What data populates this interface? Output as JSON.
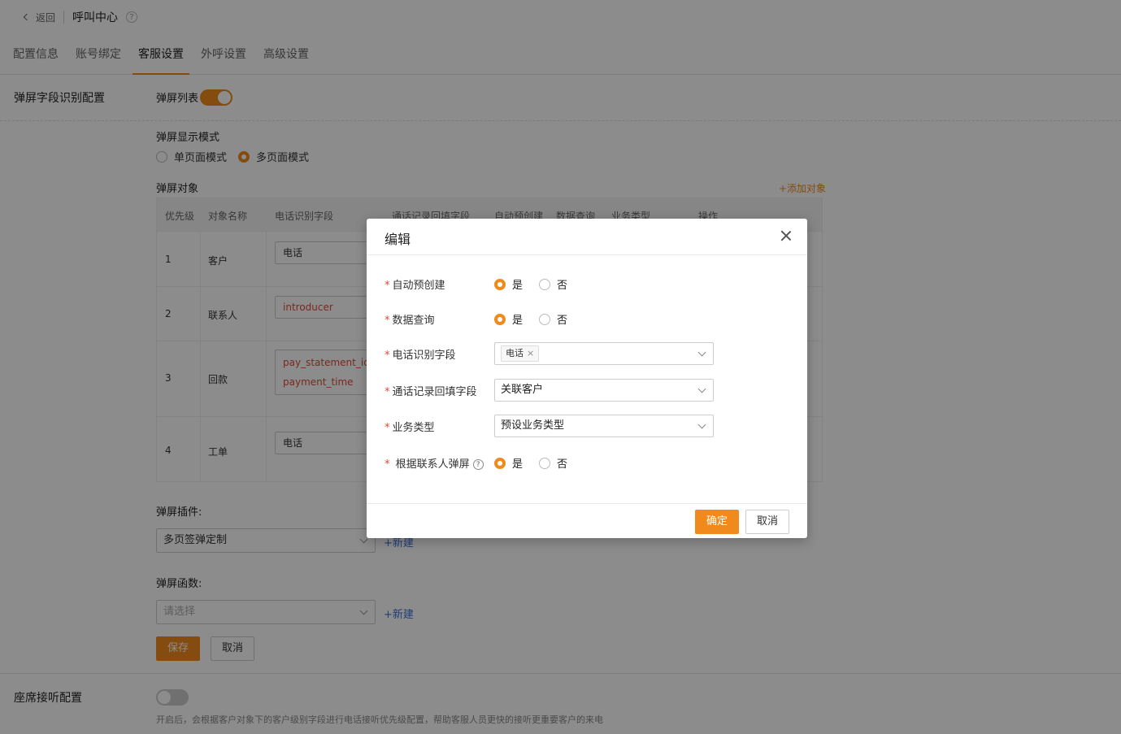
{
  "topbar": {
    "back": "返回",
    "title": "呼叫中心",
    "help": "?"
  },
  "tabs": [
    "配置信息",
    "账号绑定",
    "客服设置",
    "外呼设置",
    "高级设置"
  ],
  "popup_section": {
    "label": "弹屏字段识别配置",
    "list_label": "弹屏列表",
    "list_enabled": true,
    "display_mode_label": "弹屏显示模式",
    "display_modes": [
      "单页面模式",
      "多页面模式"
    ],
    "display_mode_selected": "多页面模式",
    "objects_label": "弹屏对象",
    "add_object": "+添加对象",
    "table": {
      "headers": [
        "优先级",
        "对象名称",
        "电话识别字段",
        "通话记录回填字段",
        "自动预创建",
        "数据查询",
        "业务类型",
        "操作"
      ],
      "rows": [
        {
          "priority": "1",
          "name": "客户",
          "phone_field": "电话"
        },
        {
          "priority": "2",
          "name": "联系人",
          "phone_field": "introducer"
        },
        {
          "priority": "3",
          "name": "回款",
          "phone_field_1": "pay_statement_id",
          "phone_field_2": "payment_time"
        },
        {
          "priority": "4",
          "name": "工单",
          "phone_field": "电话"
        }
      ]
    },
    "plugin_label": "弹屏插件:",
    "plugin_value": "多页签弹定制",
    "function_label": "弹屏函数:",
    "function_placeholder": "请选择",
    "new_link": "+新建",
    "save": "保存",
    "cancel": "取消"
  },
  "seat_section": {
    "label": "座席接听配置",
    "enabled": false,
    "hint": "开启后，会根据客户对象下的客户级别字段进行电话接听优先级配置，帮助客服人员更快的接听更重要客户的来电"
  },
  "modal": {
    "title": "编辑",
    "required_mark": "*",
    "fields": {
      "auto_create": {
        "label": "自动预创建",
        "yes": "是",
        "no": "否",
        "value": "是"
      },
      "data_query": {
        "label": "数据查询",
        "yes": "是",
        "no": "否",
        "value": "是"
      },
      "phone_field": {
        "label": "电话识别字段",
        "tag": "电话",
        "tag_close": "×"
      },
      "callback_field": {
        "label": "通话记录回填字段",
        "value": "关联客户"
      },
      "business_type": {
        "label": "业务类型",
        "value": "预设业务类型"
      },
      "by_contact": {
        "label": "根据联系人弹屏",
        "help": "?",
        "yes": "是",
        "no": "否",
        "value": "是"
      }
    },
    "confirm": "确定",
    "cancel": "取消"
  },
  "colors": {
    "accent": "#f08a1c",
    "link": "#3b6fd8",
    "required": "#e04a3a"
  }
}
